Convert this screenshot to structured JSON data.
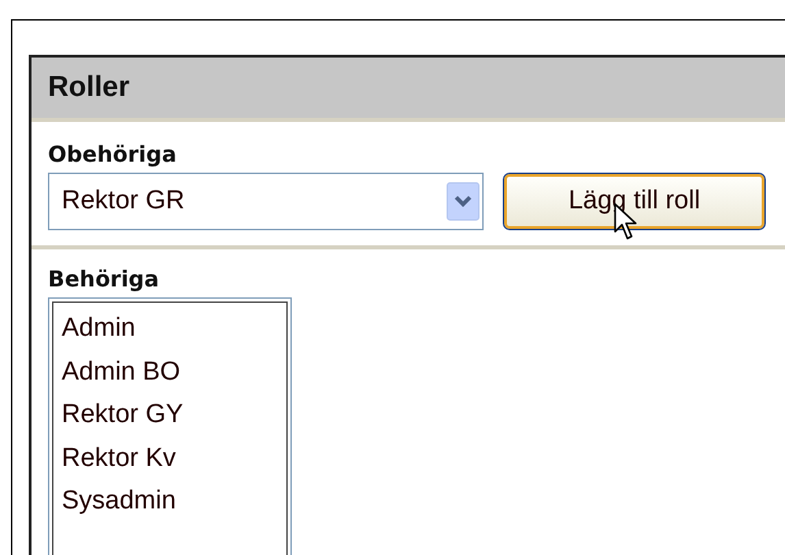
{
  "panel": {
    "title": "Roller"
  },
  "unauthorized": {
    "label": "Obehöriga",
    "select_value": "Rektor GR",
    "button": "Lägg till roll"
  },
  "authorized": {
    "label": "Behöriga",
    "items": [
      {
        "label": "Admin",
        "selected": false
      },
      {
        "label": "Admin BO",
        "selected": false
      },
      {
        "label": "Rektor GY",
        "selected": false
      },
      {
        "label": "Rektor Kv",
        "selected": false
      },
      {
        "label": "Sysadmin",
        "selected": false
      }
    ]
  }
}
